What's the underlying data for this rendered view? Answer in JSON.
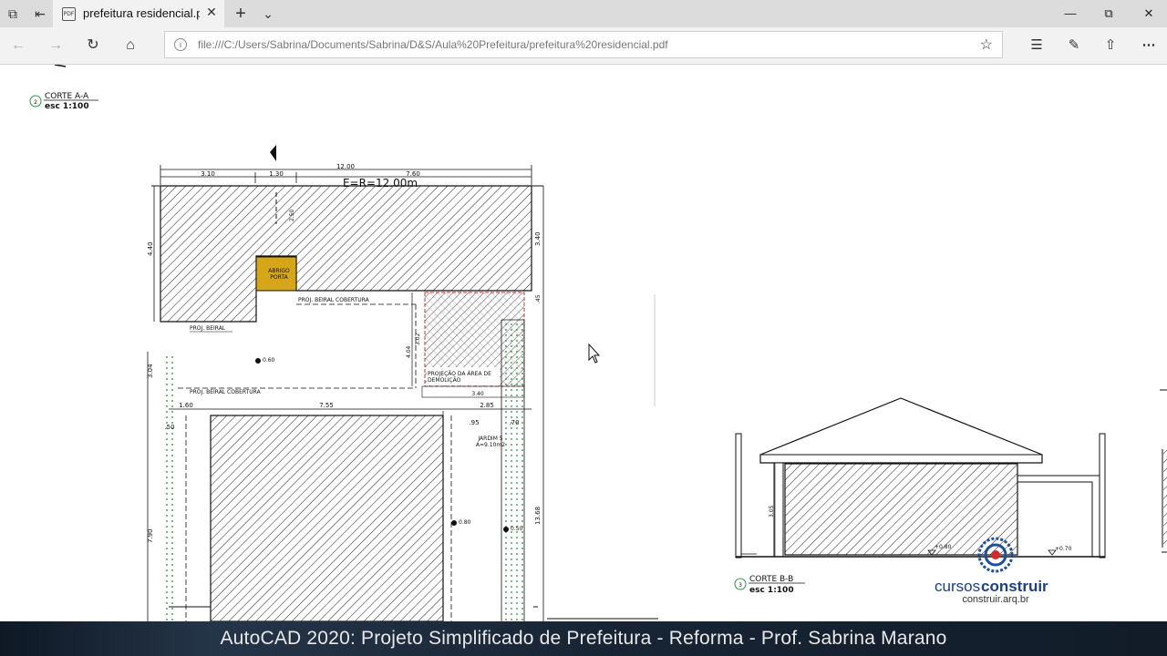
{
  "browser": {
    "tab_title": "prefeitura residencial.pdf",
    "tab_favicon": "PDF",
    "url": "file:///C:/Users/Sabrina/Documents/Sabrina/D&S/Aula%20Prefeitura/prefeitura%20residencial.pdf",
    "icons": {
      "set-aside-tabs": "tab-stack-icon",
      "tab-preview": "tab-preview-icon",
      "new-tab": "plus-icon",
      "tab-list": "chevron-down-icon",
      "back": "arrow-left-icon",
      "forward": "arrow-right-icon",
      "refresh": "refresh-icon",
      "home": "home-icon",
      "info": "info-icon",
      "favorite": "star-icon",
      "favorites-hub": "favorites-list-icon",
      "notes": "pen-icon",
      "share": "share-icon",
      "more": "ellipsis-icon"
    }
  },
  "drawing": {
    "corte_aa": {
      "number": "2",
      "title": "CORTE A-A",
      "scale": "esc 1:100"
    },
    "top_dims": {
      "total": "12.00",
      "left": "3.10",
      "mid": "1.30",
      "right": "7.60"
    },
    "testada": "E=R=12.00m",
    "side_dims": {
      "left_top": "4.40",
      "left_mid": "3.04",
      "left_bottom": "7.90",
      "right_top": "3.40",
      "right_small": ".45",
      "right_bottom": "13.68",
      "inner_vertical": "2.50",
      "inner_404": "4.04",
      "inner_302": "3.02"
    },
    "labels": {
      "abrigo": "ABRIGO",
      "porta": "PORTA",
      "proj_beiral": "PROJ. BEIRAL",
      "proj_beiral_cobertura_1": "PROJ. BEIRAL COBERTURA",
      "proj_beiral_cobertura_2": "PROJ. BEIRAL COBERTURA",
      "projecao_1": "PROJEÇÃO DA ÁREA DE",
      "projecao_2": "DEMOLIÇÃO",
      "jardim": "JARDIM 5",
      "jardim_area": "A=9.10m2"
    },
    "mid_dims": {
      "d160": "1.60",
      "d755": "7.55",
      "d285": "2.85",
      "d340": "3.40",
      "d050": ".50",
      "d095": ".95",
      "d070": ".70"
    },
    "levels": {
      "l1": "0.60",
      "l2": "0.80",
      "l3": "0.50"
    },
    "corte_bb": {
      "number": "3",
      "title": "CORTE B-B",
      "scale": "esc 1:100",
      "height": "3.05",
      "level_a": "+0.80",
      "level_b": "+0.70"
    },
    "logo": {
      "name_part1": "cursos",
      "name_part2": "construir",
      "site": "construir.arq.br"
    }
  },
  "caption": "AutoCAD 2020: Projeto Simplificado de Prefeitura - Reforma - Prof. Sabrina Marano"
}
